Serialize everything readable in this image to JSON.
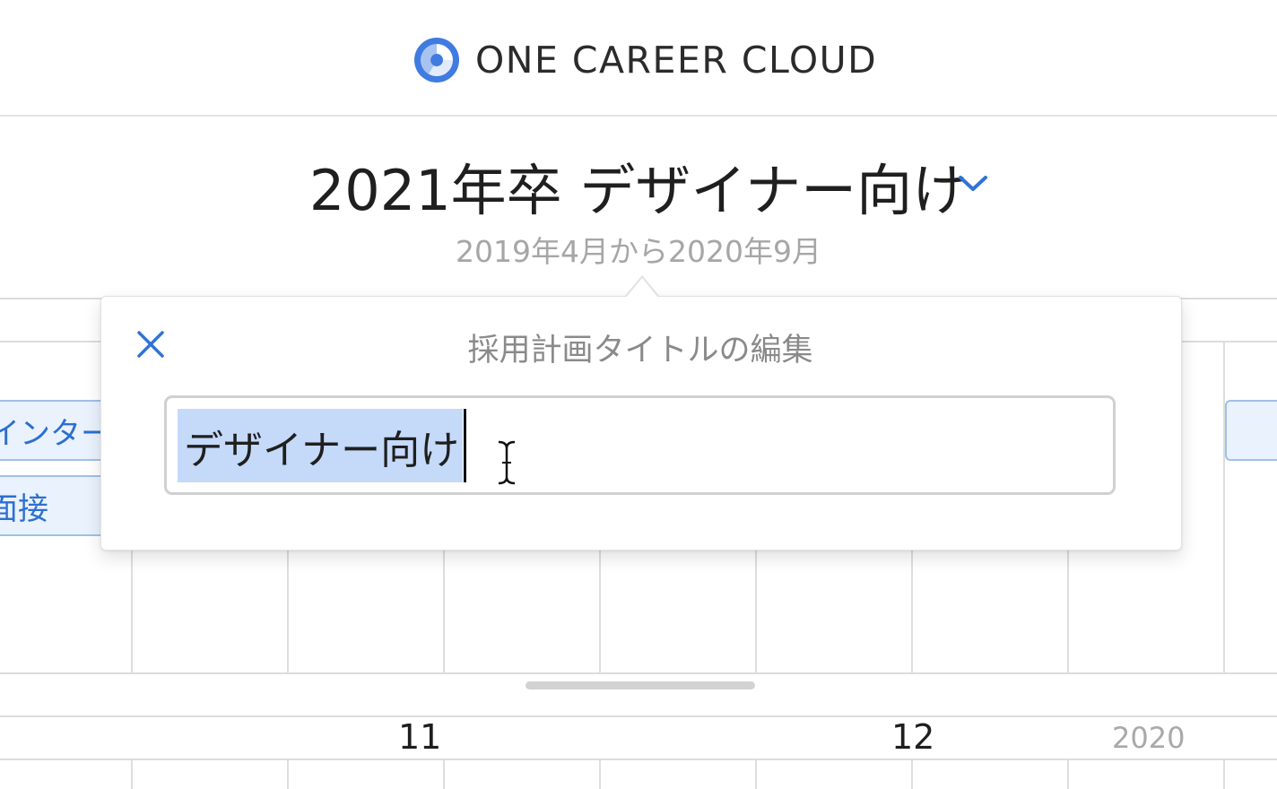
{
  "header": {
    "brand_name": "ONE CAREER CLOUD",
    "logo_icon": "one-career-logo",
    "brand_color": "#4a7fe0"
  },
  "plan": {
    "title": "2021年卒 デザイナー向け",
    "period": "2019年4月から2020年9月",
    "dropdown_icon": "chevron-down-icon"
  },
  "calendar": {
    "events": [
      {
        "label": "インター"
      },
      {
        "label": "面接"
      },
      {
        "label": ""
      }
    ],
    "months": [
      "11",
      "12"
    ],
    "year": "2020"
  },
  "edit_dialog": {
    "title": "採用計画タイトルの編集",
    "close_icon": "close-icon",
    "input_value": "デザイナー向け",
    "accent_color": "#2f73d8"
  }
}
